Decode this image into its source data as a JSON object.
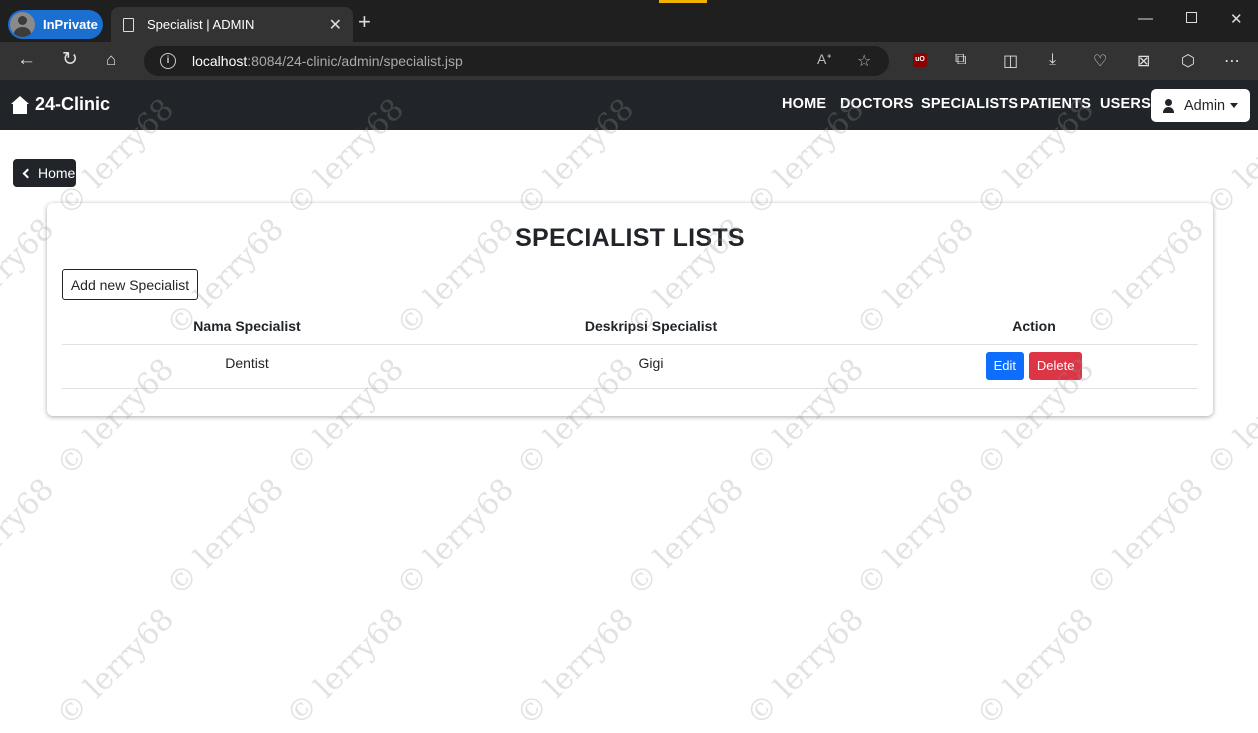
{
  "browser": {
    "profile_label": "InPrivate",
    "tab_title": "Specialist | ADMIN",
    "url_host": "localhost",
    "url_rest": ":8084/24-clinic/admin/specialist.jsp"
  },
  "navbar": {
    "brand": "24-Clinic",
    "links": [
      "HOME",
      "DOCTORS",
      "SPECIALISTS",
      "PATIENTS",
      "USERS"
    ],
    "admin_label": "Admin"
  },
  "page": {
    "back_label": "Home",
    "title": "SPECIALIST LISTS",
    "add_label": "Add new Specialist"
  },
  "table": {
    "headers": [
      "Nama Specialist",
      "Deskripsi Specialist",
      "Action"
    ],
    "rows": [
      {
        "nama": "Dentist",
        "deskripsi": "Gigi",
        "edit_label": "Edit",
        "delete_label": "Delete"
      }
    ]
  },
  "watermark": "© lerry68"
}
